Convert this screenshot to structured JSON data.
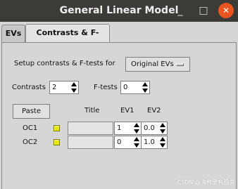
{
  "window": {
    "title": "General Linear Model",
    "minimize_glyph": "_",
    "maximize_glyph": "□",
    "close_glyph": "✕"
  },
  "tabs": [
    {
      "label": "EVs",
      "active": false
    },
    {
      "label": "Contrasts & F-tests",
      "active": true
    }
  ],
  "setup": {
    "label": "Setup contrasts & F-tests for",
    "selected": "Original EVs"
  },
  "contrasts": {
    "label": "Contrasts",
    "value": "2"
  },
  "ftests": {
    "label": "F-tests",
    "value": "0"
  },
  "table": {
    "paste_label": "Paste",
    "headers": {
      "title": "Title",
      "ev1": "EV1",
      "ev2": "EV2"
    },
    "rows": [
      {
        "label": "OC1",
        "title": "",
        "ev1": "1",
        "ev2": "0.0"
      },
      {
        "label": "OC2",
        "title": "",
        "ev1": "0",
        "ev2": "1.0"
      }
    ]
  },
  "watermark": "CSDN @海绵里有肌肉"
}
